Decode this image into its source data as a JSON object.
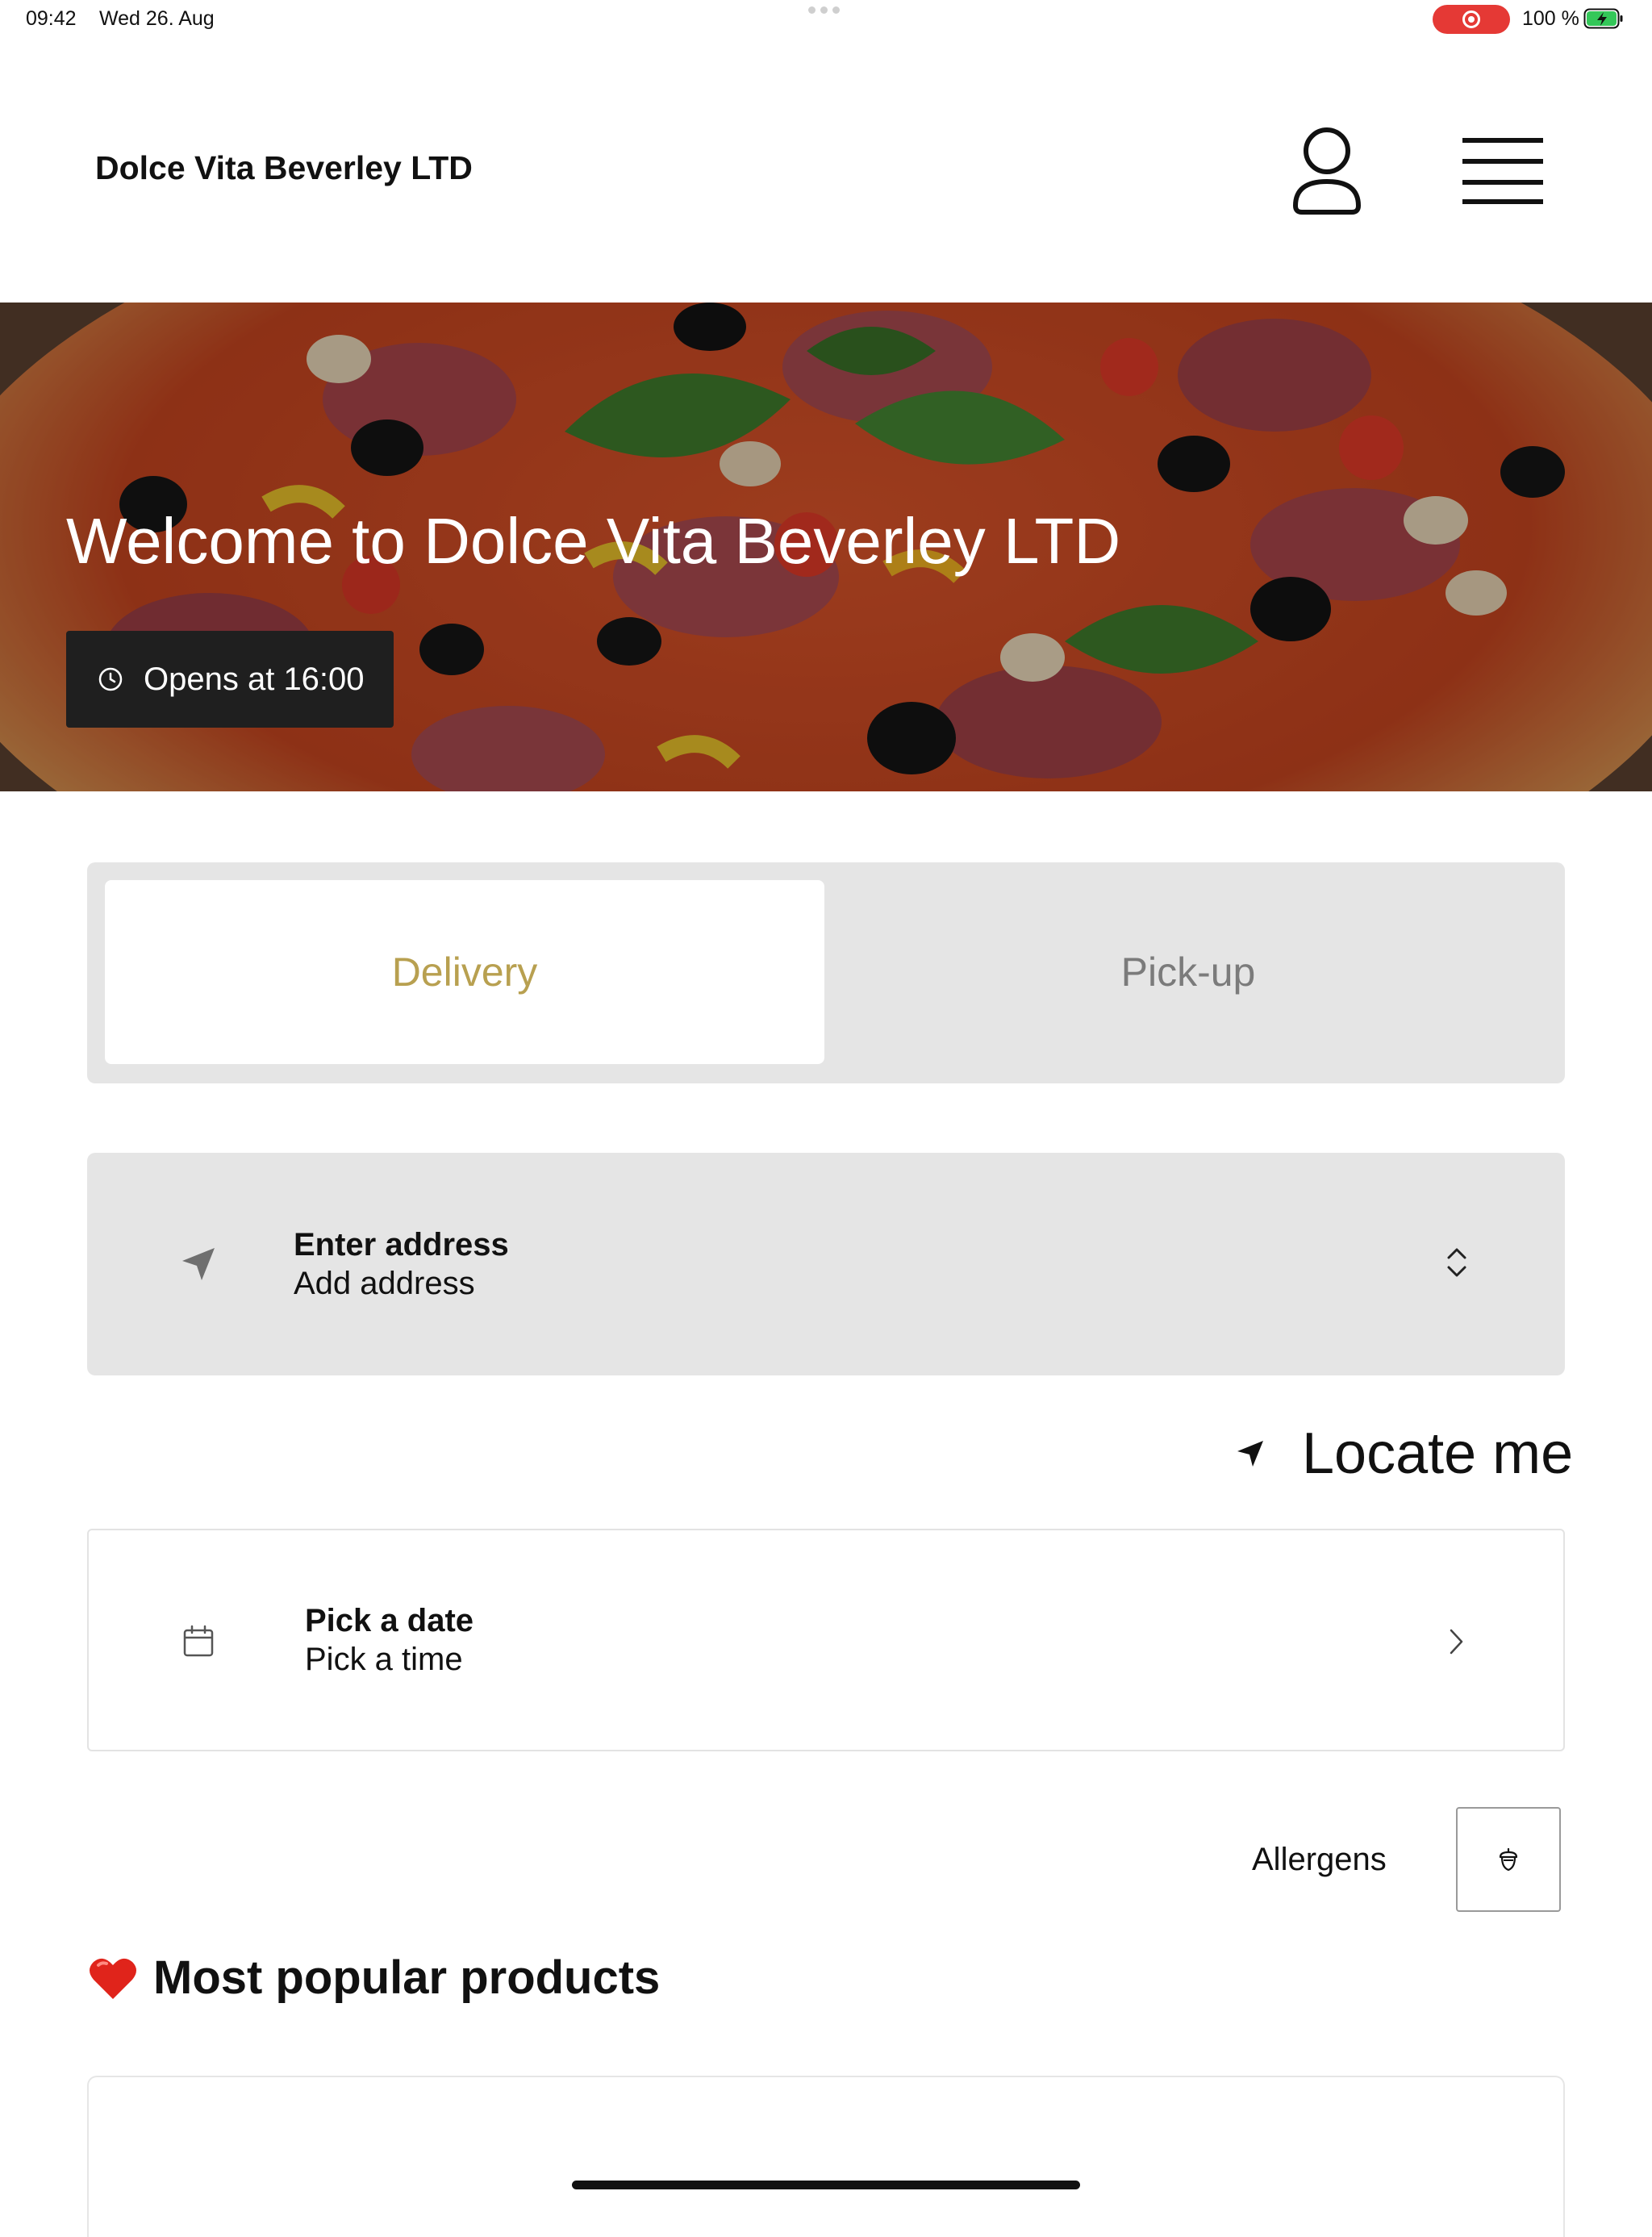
{
  "status_bar": {
    "time": "09:42",
    "date": "Wed 26. Aug",
    "battery": "100 %"
  },
  "header": {
    "title": "Dolce Vita Beverley LTD",
    "account_icon": "person-icon",
    "menu_icon": "hamburger-menu-icon"
  },
  "hero": {
    "title": "Welcome to Dolce Vita Beverley LTD",
    "opening_text": "Opens at 16:00",
    "clock_icon": "clock-icon"
  },
  "order_mode": {
    "options": [
      "Delivery",
      "Pick-up"
    ],
    "selected": "Delivery",
    "selected_color": "#b8a050",
    "unselected_color": "#7b7b7b"
  },
  "address": {
    "title": "Enter address",
    "subtitle": "Add address",
    "icon": "location-arrow-icon",
    "trailing_icon": "chevron-up-down-icon"
  },
  "locate_me": {
    "label": "Locate me",
    "icon": "location-arrow-icon"
  },
  "schedule": {
    "title": "Pick a date",
    "subtitle": "Pick a time",
    "icon": "calendar-icon",
    "trailing_icon": "chevron-right-icon"
  },
  "allergens": {
    "label": "Allergens",
    "icon": "acorn-icon"
  },
  "popular": {
    "heading": "Most popular products",
    "icon": "red-heart-icon"
  },
  "colors": {
    "accent": "#b8a050",
    "recording": "#e53935",
    "battery_fill": "#34c759"
  }
}
